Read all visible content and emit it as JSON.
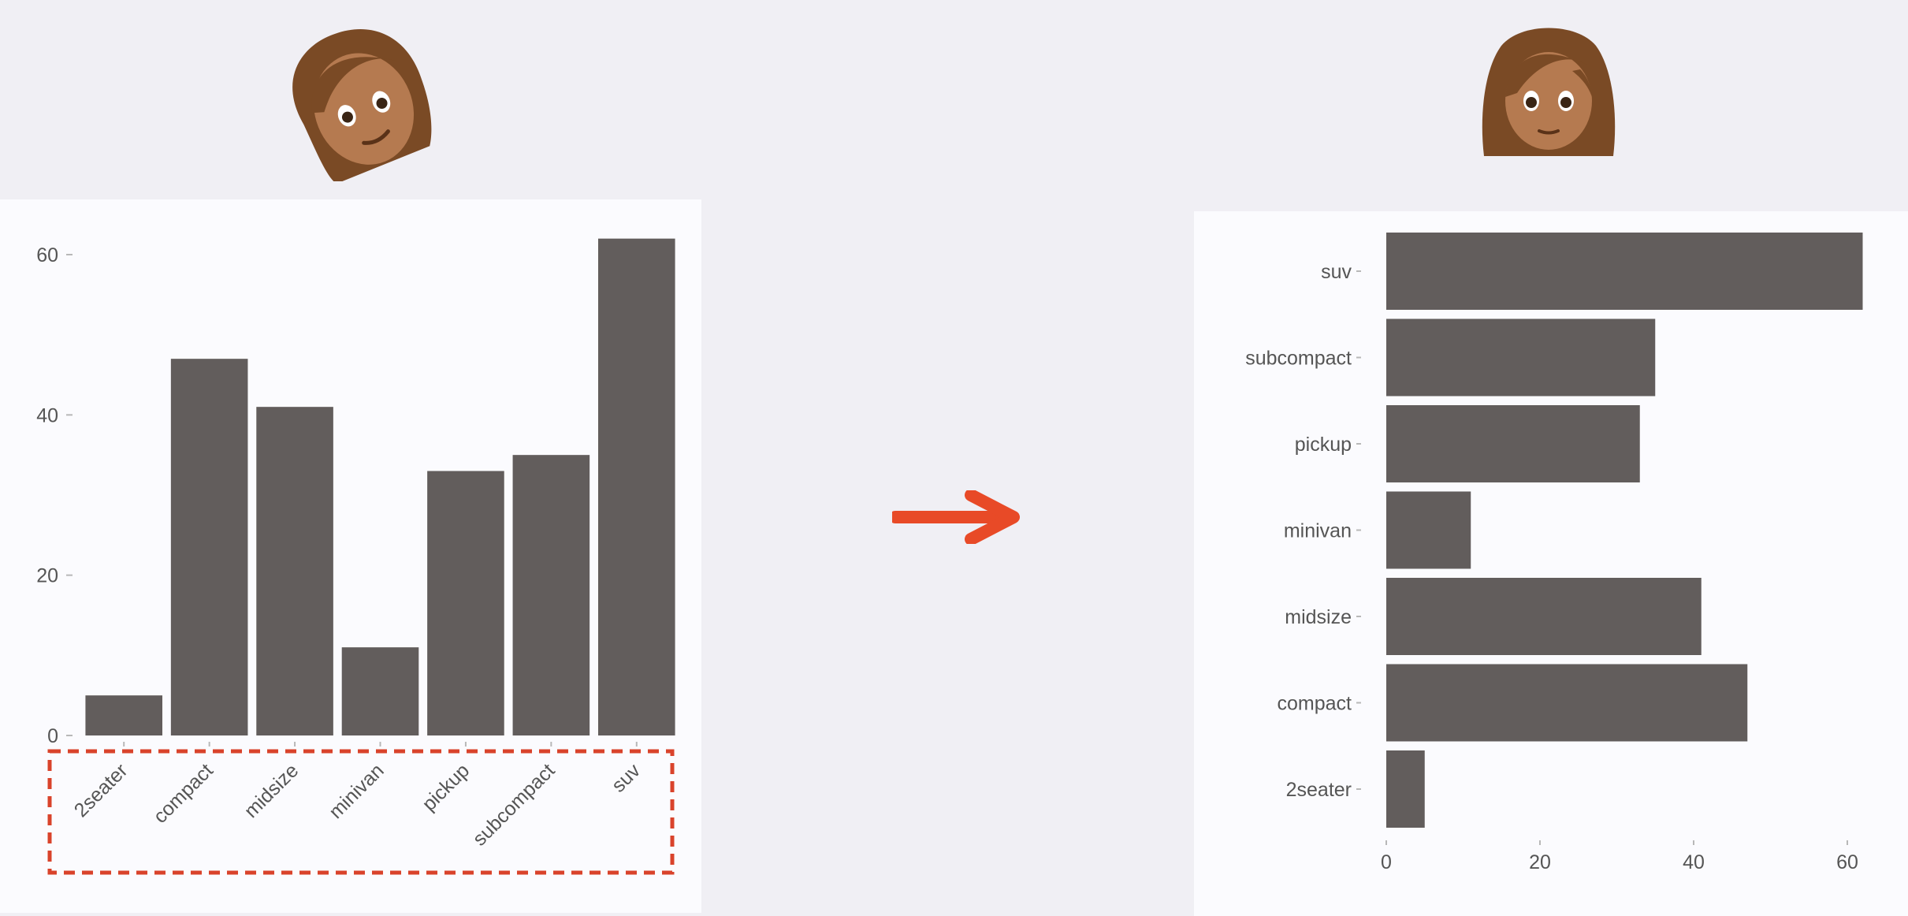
{
  "colors": {
    "background": "#f0eff4",
    "panel": "#fbfbfe",
    "bar": "#625d5c",
    "arrow": "#e84a27",
    "highlight_box": "#d9432b",
    "axis_text": "#555555"
  },
  "icons": {
    "left_person": "woman-tilted-head-icon",
    "right_person": "woman-upright-icon",
    "arrow": "right-arrow-icon"
  },
  "chart_data": [
    {
      "type": "bar",
      "orientation": "vertical",
      "categories": [
        "2seater",
        "compact",
        "midsize",
        "minivan",
        "pickup",
        "subcompact",
        "suv"
      ],
      "values": [
        5,
        47,
        41,
        11,
        33,
        35,
        62
      ],
      "yticks": [
        "0",
        "20",
        "40",
        "60"
      ],
      "ylim": [
        0,
        65
      ],
      "grid": false,
      "title": "",
      "xlabel": "",
      "ylabel": "",
      "annotation": "dashed-box-around-x-tick-labels"
    },
    {
      "type": "bar",
      "orientation": "horizontal",
      "categories": [
        "2seater",
        "compact",
        "midsize",
        "minivan",
        "pickup",
        "subcompact",
        "suv"
      ],
      "values": [
        5,
        47,
        41,
        11,
        33,
        35,
        62
      ],
      "xticks": [
        "0",
        "20",
        "40",
        "60"
      ],
      "xlim": [
        0,
        64
      ],
      "grid": false,
      "title": "",
      "xlabel": "",
      "ylabel": ""
    }
  ]
}
